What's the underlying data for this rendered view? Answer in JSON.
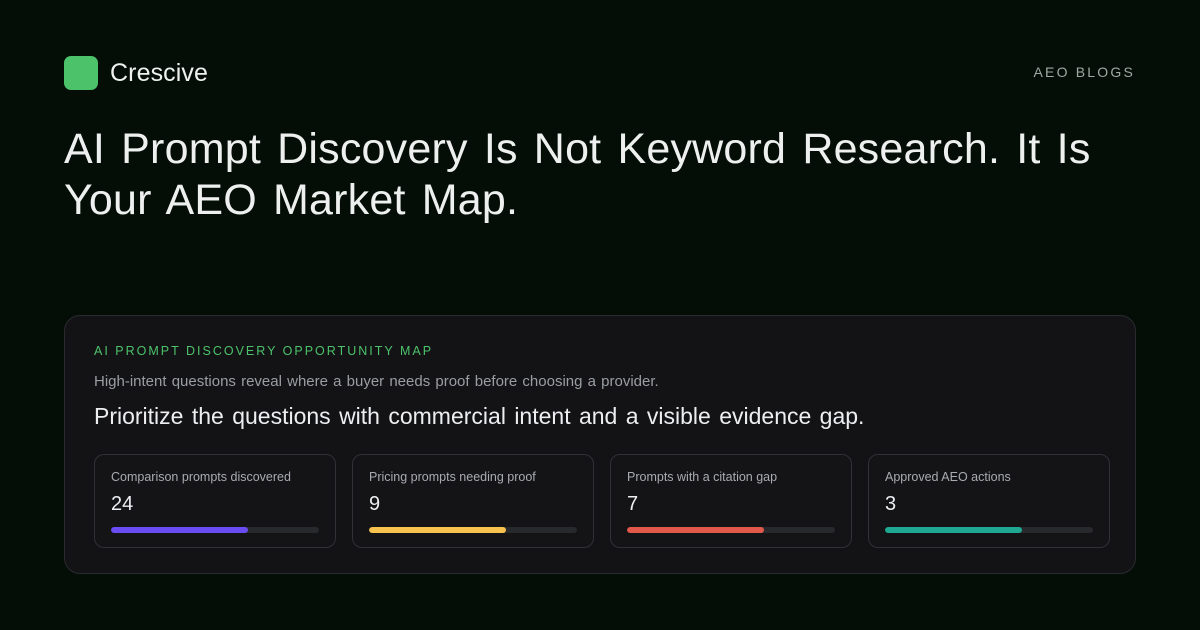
{
  "brand": {
    "name": "Crescive",
    "logo_color": "#4cc26a"
  },
  "section_tag": "AEO BLOGS",
  "headline": "AI Prompt Discovery Is Not Keyword Research. It Is Your AEO Market Map.",
  "card": {
    "eyebrow": "AI PROMPT DISCOVERY OPPORTUNITY MAP",
    "eyebrow_color": "#4cc26a",
    "subtitle": "High-intent questions reveal where a buyer needs proof before choosing a provider.",
    "title": "Prioritize the questions with commercial intent and a visible evidence gap.",
    "metrics": [
      {
        "label": "Comparison prompts discovered",
        "value": "24",
        "progress": 0.66,
        "color": "#6a4cf3"
      },
      {
        "label": "Pricing prompts needing proof",
        "value": "9",
        "progress": 0.66,
        "color": "#f7c24d"
      },
      {
        "label": "Prompts with a citation gap",
        "value": "7",
        "progress": 0.66,
        "color": "#e2584b"
      },
      {
        "label": "Approved AEO actions",
        "value": "3",
        "progress": 0.66,
        "color": "#1fa892"
      }
    ]
  }
}
